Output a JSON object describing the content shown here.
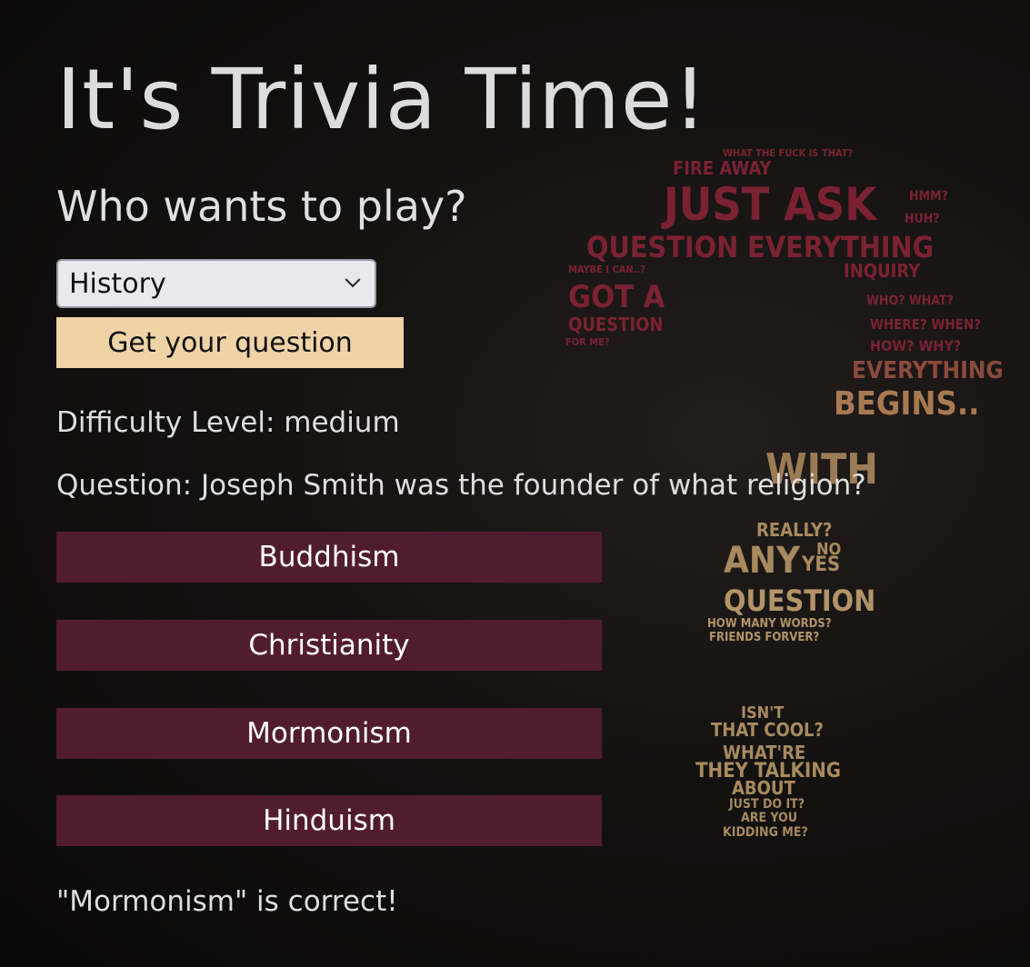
{
  "title": "It's Trivia Time!",
  "subtitle": "Who wants to play?",
  "category_select": {
    "selected": "History"
  },
  "get_question_label": "Get your question",
  "difficulty_text": "Difficulty Level: medium",
  "question_text": "Question: Joseph Smith was the founder of what religion?",
  "answers": [
    {
      "label": "Buddhism"
    },
    {
      "label": "Christianity"
    },
    {
      "label": "Mormonism"
    },
    {
      "label": "Hinduism"
    }
  ],
  "result_text": "\"Mormonism\" is correct!",
  "background_words": {
    "w1": "WHAT THE FUCK IS THAT?",
    "w2": "FIRE AWAY",
    "w3": "JUST ASK",
    "w4": "QUESTION EVERYTHING",
    "w5": "INQUIRY",
    "w6": "GOT A",
    "w7": "QUESTION",
    "w8": "FOR ME?",
    "w9": "WHO? WHAT?",
    "w10": "WHERE? WHEN?",
    "w11": "HOW? WHY?",
    "w12": "EVERYTHING",
    "w13": "BEGINS..",
    "w14": "WITH",
    "w15": "REALLY?",
    "w16": "ANY",
    "w17": "NO",
    "w18": "YES",
    "w19": "QUESTION",
    "w20": "HOW MANY WORDS?",
    "w21": "FRIENDS FORVER?",
    "w22": "ISN'T",
    "w23": "THAT COOL?",
    "w24": "WHAT'RE",
    "w25": "THEY TALKING",
    "w26": "ABOUT",
    "w27": "JUST DO IT?",
    "w28": "ARE YOU",
    "w29": "KIDDING ME?",
    "w30": "MAYBE I CAN..?",
    "w31": "HUH?",
    "w32": "HMM?"
  },
  "colors": {
    "answer_bg": "#521c2f",
    "question_btn_bg": "#efd3a6",
    "text": "#dedede",
    "art_red": "#7a2232",
    "art_gold": "#b89b6a"
  }
}
